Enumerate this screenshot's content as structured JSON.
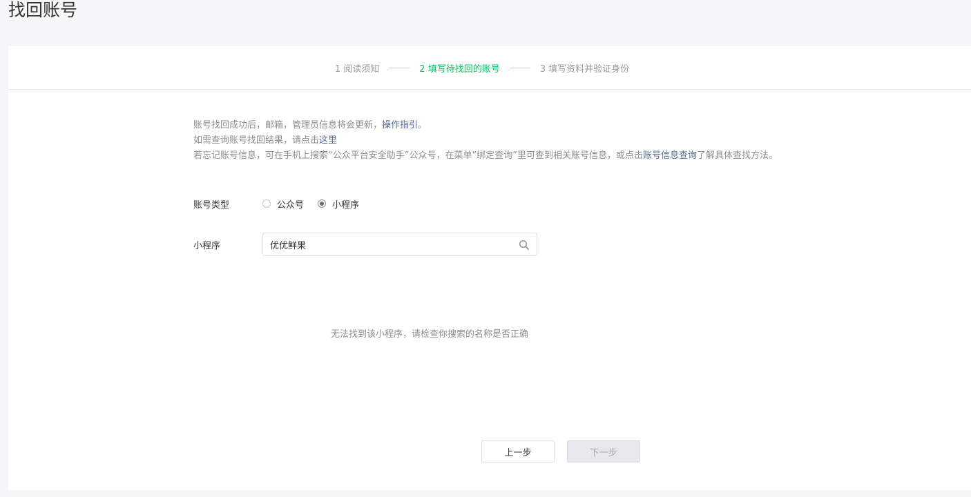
{
  "page": {
    "title": "找回账号"
  },
  "steps": [
    {
      "label": "1 阅读须知",
      "active": false
    },
    {
      "label": "2 填写待找回的账号",
      "active": true
    },
    {
      "label": "3 填写资料并验证身份",
      "active": false
    }
  ],
  "notice": {
    "line1_text": "账号找回成功后，邮箱，管理员信息将会更新，",
    "line1_link": "操作指引",
    "line1_end": "。",
    "line2_text": "如需查询账号找回结果，请点击",
    "line2_link": "这里",
    "line3_text": "若忘记账号信息，可在手机上搜索“公众平台安全助手”公众号，在菜单“绑定查询”里可查到相关账号信息，或点击",
    "line3_link": "账号信息查询",
    "line3_end": "了解具体查找方法。"
  },
  "form": {
    "account_type_label": "账号类型",
    "options": [
      {
        "label": "公众号",
        "checked": false
      },
      {
        "label": "小程序",
        "checked": true
      }
    ],
    "app_label": "小程序",
    "search_value": "优优鲜果"
  },
  "result": {
    "message": "无法找到该小程序，请检查你搜索的名称是否正确"
  },
  "buttons": {
    "prev": "上一步",
    "next": "下一步"
  },
  "colors": {
    "accent": "#07c160",
    "link": "#576b95"
  }
}
